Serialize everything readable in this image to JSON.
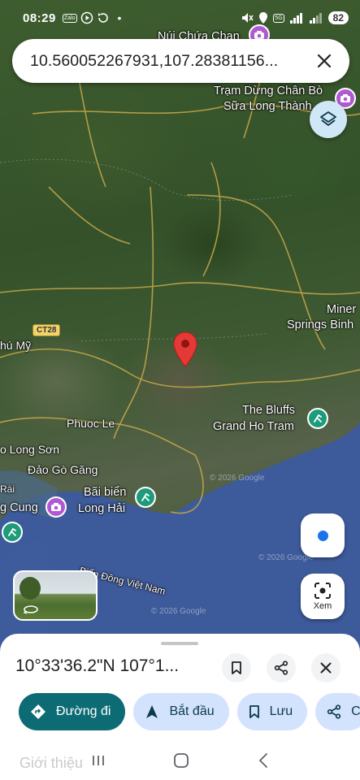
{
  "status_bar": {
    "time": "08:29",
    "small_badge": "Zalo",
    "network_label": "5G",
    "battery": "82"
  },
  "search": {
    "query": "10.560052267931,107.28381156..."
  },
  "map": {
    "labels": {
      "nui_chua_chan": "Núi Chứa Chan",
      "tram_dung_line1": "Trạm Dừng Chân Bò",
      "tram_dung_line2": "Sữa Long Thành",
      "miner_line1": "Miner",
      "miner_line2": "Springs Binh",
      "phu_my": "hú Mỹ",
      "bluffs_line1": "The Bluffs",
      "bluffs_line2": "Grand Ho Tram",
      "phuoc_le": "Phuoc Le",
      "long_son": "o Long Sơn",
      "dao_go_gang": "Đảo Gò Găng",
      "rai": "Rài",
      "bai_bien_line1": "Bãi biển",
      "bai_bien_line2": "Long Hải",
      "cung": "g Cung",
      "bien_dong": "Biển Đông Việt Nam",
      "road_badge": "CT28",
      "watermark_1": "© 2026 Google",
      "watermark_2": "© 2026 Google",
      "watermark_3": "© 2026 Google"
    }
  },
  "floating": {
    "xem_label": "Xem"
  },
  "place": {
    "coordinates": "10°33'36.2\"N 107°1..."
  },
  "actions": {
    "directions": "Đường đi",
    "start": "Bắt đầu",
    "save": "Lưu",
    "share_partial": "C"
  },
  "tabs": {
    "overview": "Giới thiệu"
  },
  "icons": [
    "camera-icon",
    "layers-icon",
    "close-icon",
    "pin-icon",
    "bookmark-icon",
    "share-icon",
    "directions-icon",
    "navigation-icon",
    "hiking-icon",
    "panorama-360-icon"
  ],
  "colors": {
    "primary_button": "#0d6b73",
    "chip_bg": "#d3e3fd",
    "chip_text": "#0b57d0",
    "pin": "#e53935",
    "location_dot": "#1a73e8"
  }
}
